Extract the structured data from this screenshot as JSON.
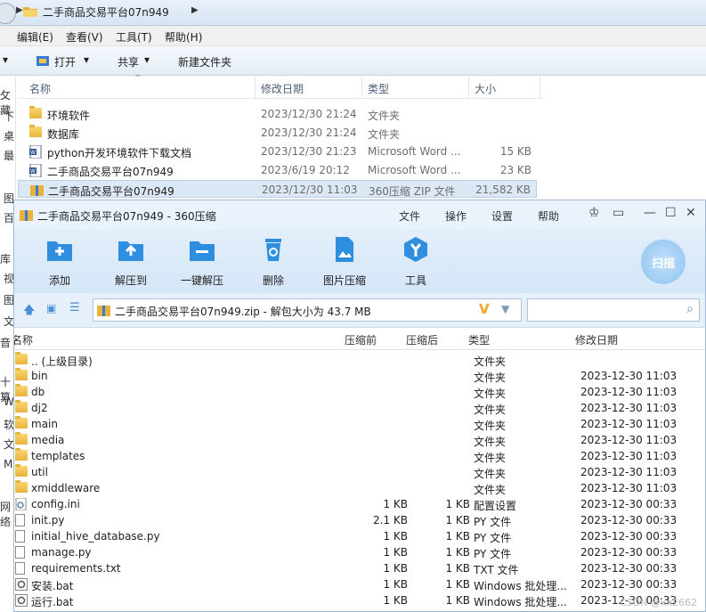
{
  "explorer": {
    "breadcrumb": "二手商品交易平台07n949",
    "menu": [
      "编辑(E)",
      "查看(V)",
      "工具(T)",
      "帮助(H)"
    ],
    "toolbar": {
      "open": "打开",
      "share": "共享",
      "new_folder": "新建文件夹"
    },
    "columns": {
      "name": "名称",
      "date": "修改日期",
      "type": "类型",
      "size": "大小"
    },
    "left_nav": [
      "攵藏",
      "下",
      "桌",
      "最",
      "",
      "图",
      "百",
      "",
      "库",
      "视",
      "",
      "图",
      "文",
      "",
      "音",
      "",
      "十算",
      "W",
      "软",
      "文",
      "M",
      "",
      "网络"
    ],
    "files": [
      {
        "icon": "folder-icon",
        "name": "环境软件",
        "date": "2023/12/30 21:24",
        "type": "文件夹",
        "size": ""
      },
      {
        "icon": "folder-icon",
        "name": "数据库",
        "date": "2023/12/30 21:24",
        "type": "文件夹",
        "size": ""
      },
      {
        "icon": "word-doc-icon",
        "name": "python开发环境软件下载文档",
        "date": "2023/12/30 21:23",
        "type": "Microsoft Word ...",
        "size": "15 KB"
      },
      {
        "icon": "word-doc-icon",
        "name": "二手商品交易平台07n949",
        "date": "2023/6/19 20:12",
        "type": "Microsoft Word ...",
        "size": "23 KB"
      },
      {
        "icon": "zip-icon",
        "name": "二手商品交易平台07n949",
        "date": "2023/12/30 11:03",
        "type": "360压缩 ZIP 文件",
        "size": "21,582 KB",
        "selected": true
      }
    ]
  },
  "zip": {
    "title": "二手商品交易平台07n949 - 360压缩",
    "menu": [
      "文件",
      "操作",
      "设置",
      "帮助"
    ],
    "tools": [
      "添加",
      "解压到",
      "一键解压",
      "删除",
      "图片压缩",
      "工具"
    ],
    "scan": "扫描",
    "path": "二手商品交易平台07n949.zip - 解包大小为 43.7 MB",
    "search_placeholder": "",
    "columns": {
      "name": "名称",
      "compressed_before": "压缩前",
      "compressed_after": "压缩后",
      "type": "类型",
      "date": "修改日期"
    },
    "rows": [
      {
        "icon": "folder-icon",
        "name": ".. (上级目录)",
        "before": "",
        "after": "",
        "type": "文件夹",
        "date": ""
      },
      {
        "icon": "folder-icon",
        "name": "bin",
        "before": "",
        "after": "",
        "type": "文件夹",
        "date": "2023-12-30 11:03"
      },
      {
        "icon": "folder-icon",
        "name": "db",
        "before": "",
        "after": "",
        "type": "文件夹",
        "date": "2023-12-30 11:03"
      },
      {
        "icon": "folder-icon",
        "name": "dj2",
        "before": "",
        "after": "",
        "type": "文件夹",
        "date": "2023-12-30 11:03"
      },
      {
        "icon": "folder-icon",
        "name": "main",
        "before": "",
        "after": "",
        "type": "文件夹",
        "date": "2023-12-30 11:03"
      },
      {
        "icon": "folder-icon",
        "name": "media",
        "before": "",
        "after": "",
        "type": "文件夹",
        "date": "2023-12-30 11:03"
      },
      {
        "icon": "folder-icon",
        "name": "templates",
        "before": "",
        "after": "",
        "type": "文件夹",
        "date": "2023-12-30 11:03"
      },
      {
        "icon": "folder-icon",
        "name": "util",
        "before": "",
        "after": "",
        "type": "文件夹",
        "date": "2023-12-30 11:03"
      },
      {
        "icon": "folder-icon",
        "name": "xmiddleware",
        "before": "",
        "after": "",
        "type": "文件夹",
        "date": "2023-12-30 11:03"
      },
      {
        "icon": "settings-file-icon",
        "name": "config.ini",
        "before": "1 KB",
        "after": "1 KB",
        "type": "配置设置",
        "date": "2023-12-30 00:33"
      },
      {
        "icon": "file-icon",
        "name": "init.py",
        "before": "2.1 KB",
        "after": "1 KB",
        "type": "PY 文件",
        "date": "2023-12-30 00:33"
      },
      {
        "icon": "file-icon",
        "name": "initial_hive_database.py",
        "before": "1 KB",
        "after": "1 KB",
        "type": "PY 文件",
        "date": "2023-12-30 00:33"
      },
      {
        "icon": "file-icon",
        "name": "manage.py",
        "before": "1 KB",
        "after": "1 KB",
        "type": "PY 文件",
        "date": "2023-12-30 00:33"
      },
      {
        "icon": "file-icon",
        "name": "requirements.txt",
        "before": "1 KB",
        "after": "1 KB",
        "type": "TXT 文件",
        "date": "2023-12-30 00:33"
      },
      {
        "icon": "batch-file-icon",
        "name": "安装.bat",
        "before": "1 KB",
        "after": "1 KB",
        "type": "Windows 批处理...",
        "date": "2023-12-30 00:33"
      },
      {
        "icon": "batch-file-icon",
        "name": "运行.bat",
        "before": "1 KB",
        "after": "1 KB",
        "type": "Windows 批处理...",
        "date": "2023-12-30 00:33"
      }
    ]
  },
  "watermark": "CSDN @xx2662",
  "colors": {
    "accent": "#2f8ee0",
    "selected_row": "#dce8f6",
    "ribbon": "#d5e6f7",
    "v_icon": "#f5a623"
  }
}
